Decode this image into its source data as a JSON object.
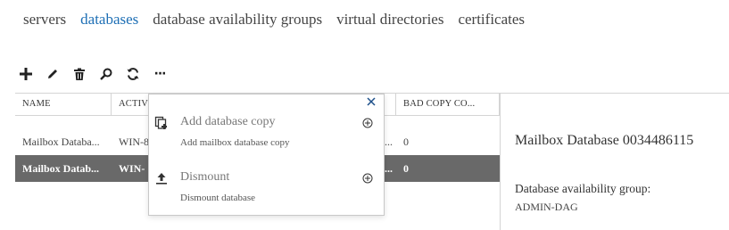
{
  "tabs": [
    {
      "label": "servers",
      "active": false
    },
    {
      "label": "databases",
      "active": true
    },
    {
      "label": "database availability groups",
      "active": false
    },
    {
      "label": "virtual directories",
      "active": false
    },
    {
      "label": "certificates",
      "active": false
    }
  ],
  "toolbar": {
    "icons": [
      "plus-icon",
      "edit-icon",
      "delete-icon",
      "search-icon",
      "refresh-icon",
      "more-icon"
    ],
    "more_label": "···"
  },
  "grid": {
    "headers": [
      "NAME",
      "ACTIV",
      "",
      "BAD COPY CO..."
    ],
    "rows": [
      [
        "Mailbox Databa...",
        "WIN-8",
        "...",
        "0"
      ],
      [
        "Mailbox Datab...",
        "WIN-",
        "...",
        "0"
      ]
    ],
    "selected_row": 1
  },
  "details": {
    "title": "Mailbox Database 0034486115",
    "label": "Database availability group:",
    "value": "ADMIN-DAG"
  },
  "popup": {
    "items": [
      {
        "title": "Add database copy",
        "subtitle": "Add mailbox database copy",
        "icon": "add-database-copy-icon"
      },
      {
        "title": "Dismount",
        "subtitle": "Dismount database",
        "icon": "dismount-icon"
      }
    ]
  },
  "colors": {
    "accent": "#1e6fb5",
    "selected_row": "#696969",
    "close_icon": "#1e4f8a"
  }
}
